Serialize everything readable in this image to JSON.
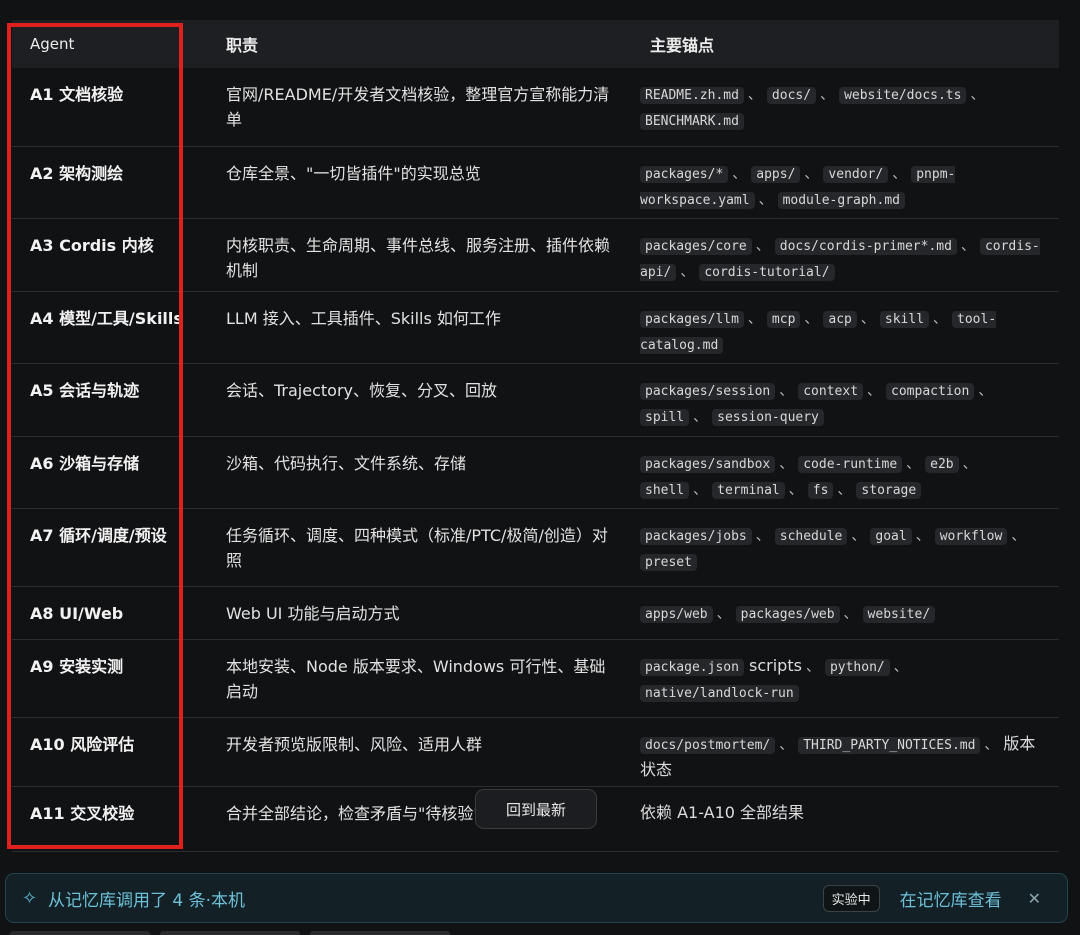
{
  "table": {
    "headers": [
      "Agent",
      "职责",
      "主要锚点"
    ],
    "rows": [
      {
        "agent": "A1 文档核验",
        "resp": "官网/README/开发者文档核验，整理官方宣称能力清单",
        "anchors": [
          {
            "c": "README.zh.md"
          },
          {
            "c": "docs/"
          },
          {
            "c": "website/docs.ts"
          },
          {
            "c": "BENCHMARK.md"
          }
        ]
      },
      {
        "agent": "A2 架构测绘",
        "resp": "仓库全景、\"一切皆插件\"的实现总览",
        "anchors": [
          {
            "c": "packages/*"
          },
          {
            "c": "apps/"
          },
          {
            "c": "vendor/"
          },
          {
            "c": "pnpm-workspace.yaml"
          },
          {
            "c": "module-graph.md"
          }
        ]
      },
      {
        "agent": "A3 Cordis 内核",
        "resp": "内核职责、生命周期、事件总线、服务注册、插件依赖机制",
        "anchors": [
          {
            "c": "packages/core"
          },
          {
            "c": "docs/cordis-primer*.md"
          },
          {
            "c": "cordis-api/"
          },
          {
            "c": "cordis-tutorial/"
          }
        ]
      },
      {
        "agent": "A4 模型/工具/Skills",
        "resp": "LLM 接入、工具插件、Skills 如何工作",
        "anchors": [
          {
            "c": "packages/llm"
          },
          {
            "c": "mcp"
          },
          {
            "c": "acp"
          },
          {
            "c": "skill"
          },
          {
            "c": "tool-catalog.md"
          }
        ]
      },
      {
        "agent": "A5 会话与轨迹",
        "resp": "会话、Trajectory、恢复、分叉、回放",
        "anchors": [
          {
            "c": "packages/session"
          },
          {
            "c": "context"
          },
          {
            "c": "compaction"
          },
          {
            "c": "spill"
          },
          {
            "c": "session-query"
          }
        ]
      },
      {
        "agent": "A6 沙箱与存储",
        "resp": "沙箱、代码执行、文件系统、存储",
        "anchors": [
          {
            "c": "packages/sandbox"
          },
          {
            "c": "code-runtime"
          },
          {
            "c": "e2b"
          },
          {
            "c": "shell"
          },
          {
            "c": "terminal"
          },
          {
            "c": "fs"
          },
          {
            "c": "storage"
          }
        ]
      },
      {
        "agent": "A7 循环/调度/预设",
        "resp": "任务循环、调度、四种模式（标准/PTC/极简/创造）对照",
        "anchors": [
          {
            "c": "packages/jobs"
          },
          {
            "c": "schedule"
          },
          {
            "c": "goal"
          },
          {
            "c": "workflow"
          },
          {
            "c": "preset"
          }
        ]
      },
      {
        "agent": "A8 UI/Web",
        "resp": "Web UI 功能与启动方式",
        "anchors": [
          {
            "c": "apps/web"
          },
          {
            "c": "packages/web"
          },
          {
            "c": "website/"
          }
        ]
      },
      {
        "agent": "A9 安装实测",
        "resp": "本地安装、Node 版本要求、Windows 可行性、基础启动",
        "anchors": [
          {
            "c": "package.json",
            "t": " scripts"
          },
          {
            "c": "python/"
          },
          {
            "c": "native/landlock-run"
          }
        ]
      },
      {
        "agent": "A10 风险评估",
        "resp": "开发者预览版限制、风险、适用人群",
        "anchors": [
          {
            "c": "docs/postmortem/"
          },
          {
            "c": "THIRD_PARTY_NOTICES.md"
          },
          {
            "t": "版本状态"
          }
        ]
      },
      {
        "agent": "A11 交叉校验",
        "resp": "合并全部结论，检查矛盾与\"待核验\"项",
        "anchors": [
          {
            "t": "依赖 A1-A10 全部结果"
          }
        ]
      }
    ]
  },
  "float_button": {
    "label": "回到最新"
  },
  "memory_bar": {
    "icon": "sparkle-icon",
    "text": "从记忆库调用了 4 条·本机",
    "badge": "实验中",
    "link": "在记忆库查看",
    "close": "✕"
  },
  "colors": {
    "highlight_box": "#e0201c",
    "accent": "#6ec0d8"
  }
}
